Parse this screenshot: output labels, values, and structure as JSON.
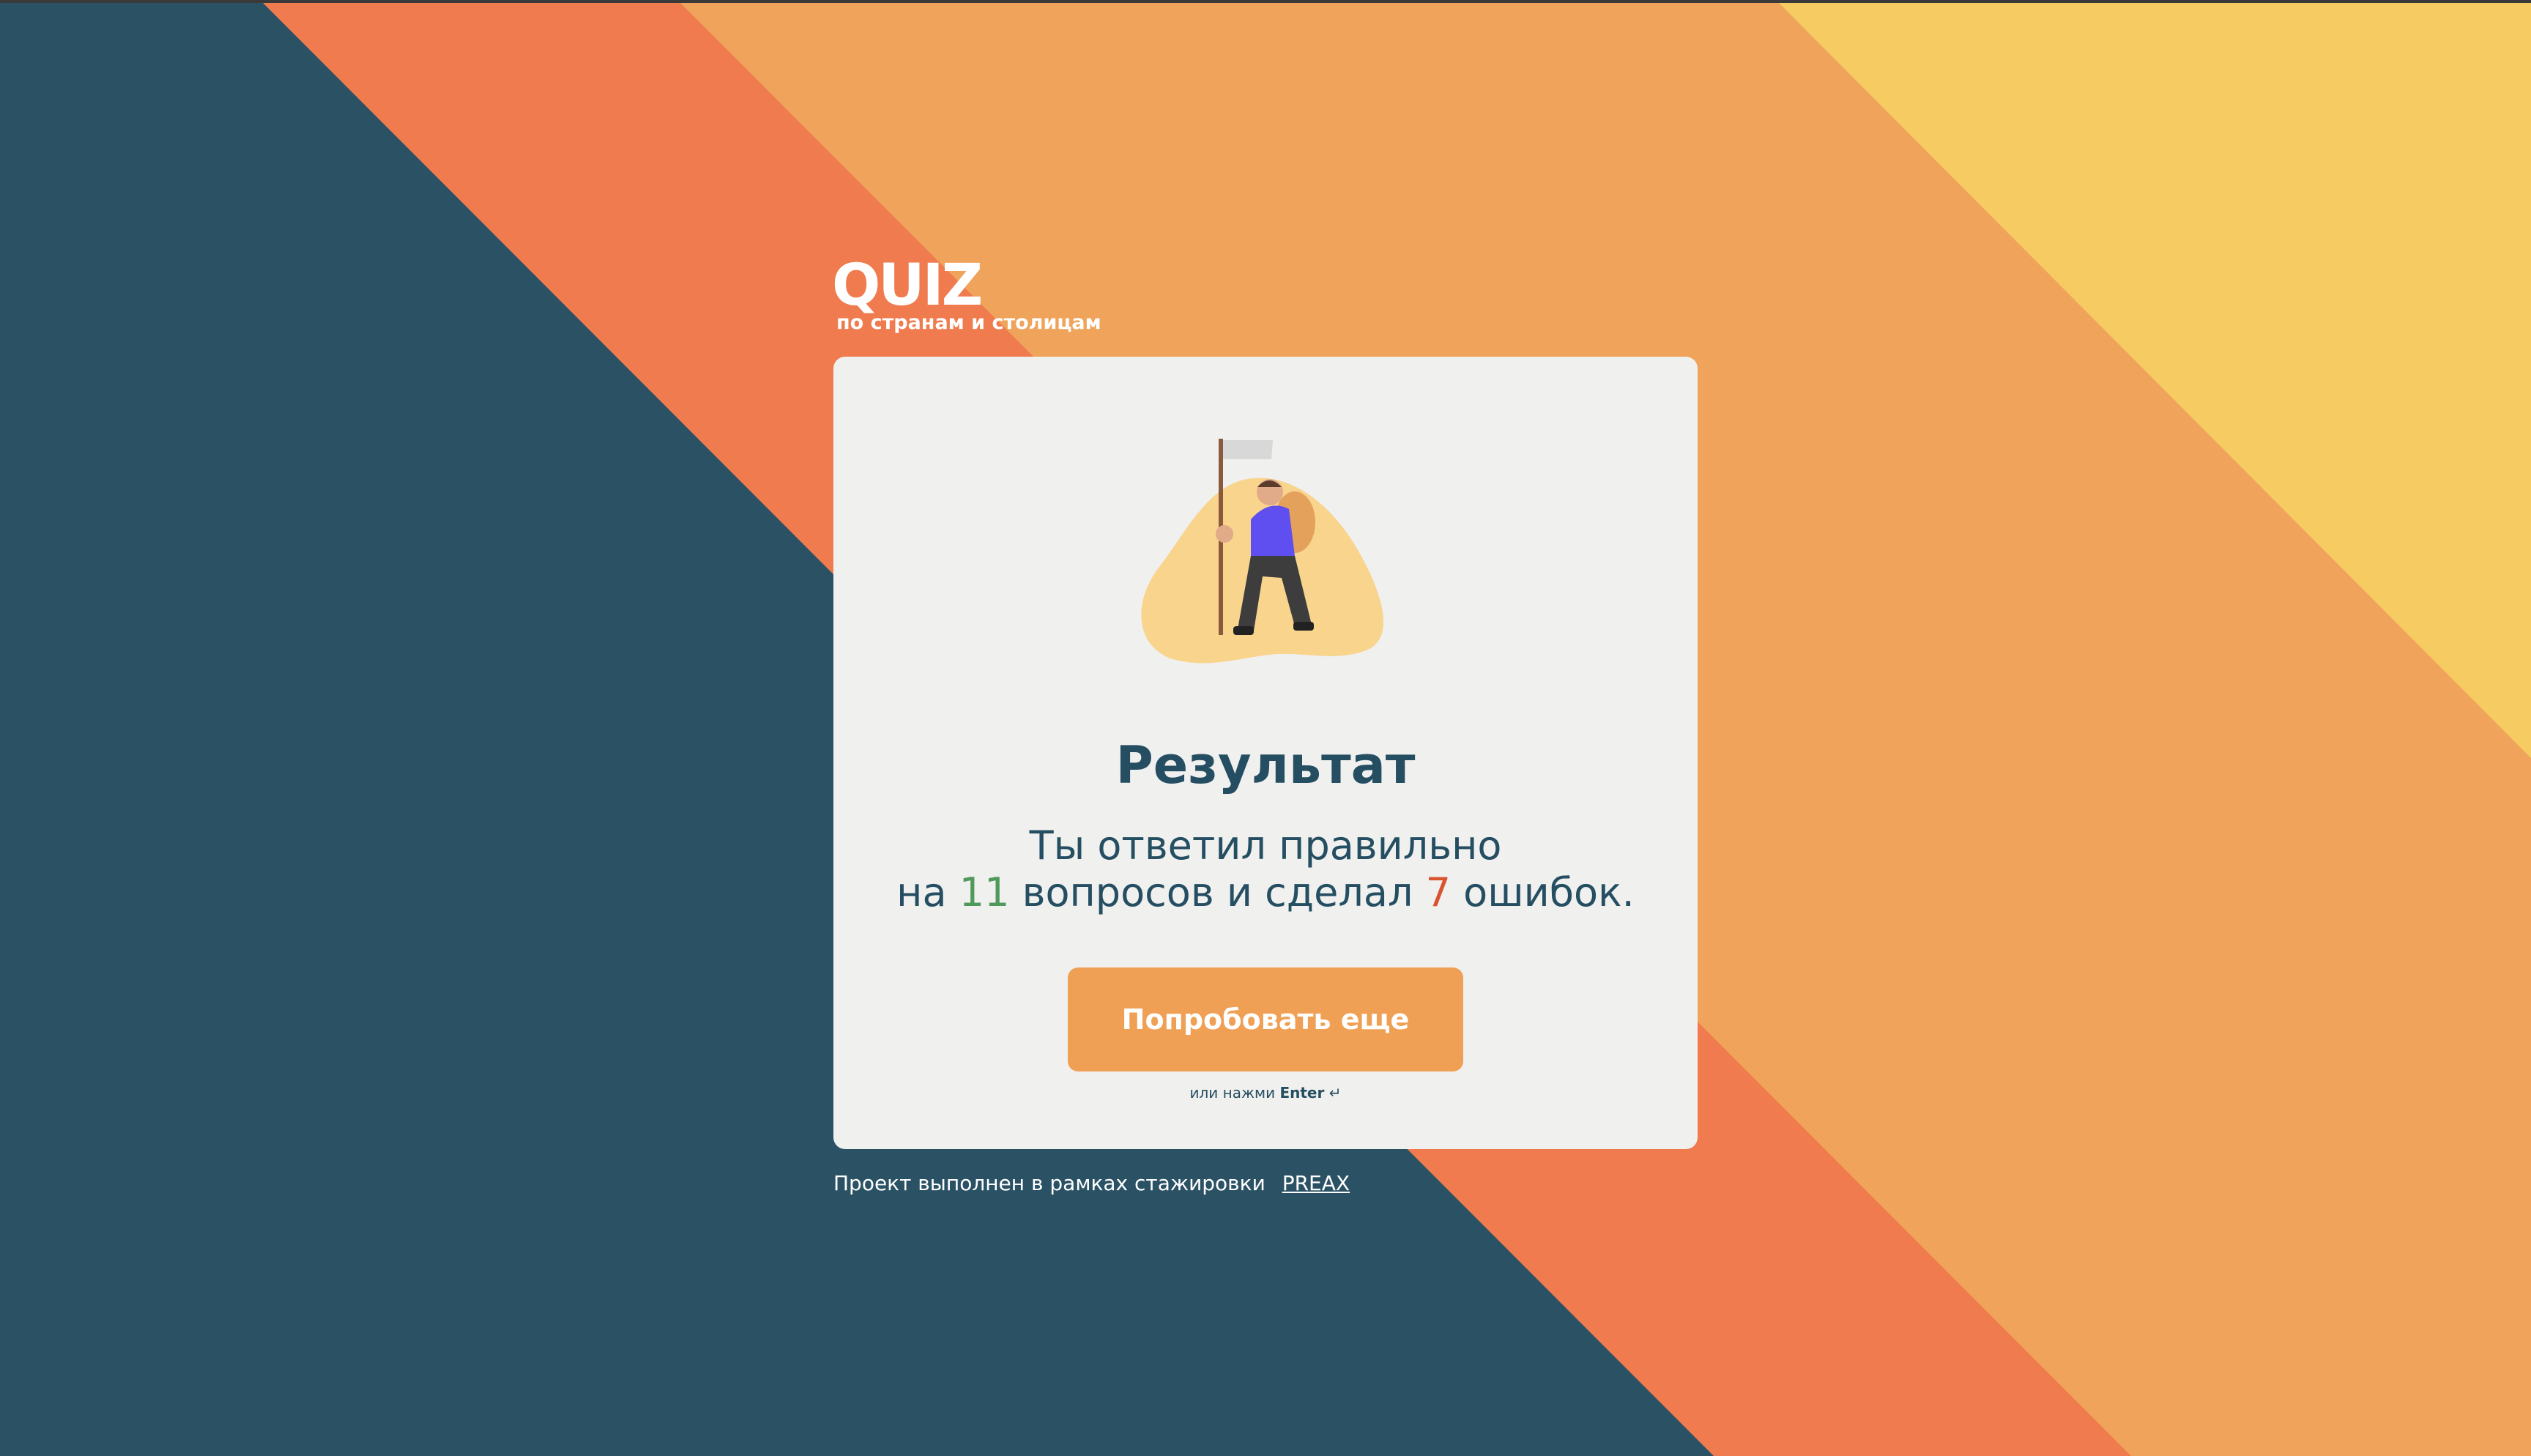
{
  "brand": {
    "title": "QUIZ",
    "subtitle": "по странам и столицам"
  },
  "result": {
    "heading": "Результат",
    "line1": "Ты ответил правильно",
    "line2_prefix": "на",
    "correct_count": "11",
    "line2_middle": "вопросов и сделал",
    "mistakes_count": "7",
    "line2_suffix": "ошибок."
  },
  "actions": {
    "retry_label": "Попробовать еще",
    "hint_prefix": "или нажми",
    "hint_key": "Enter",
    "hint_icon": "↵"
  },
  "footer": {
    "text": "Проект выполнен в рамках стажировки",
    "link_label": "PREAX"
  },
  "colors": {
    "dark_blue": "#2a5164",
    "orange_red": "#ef7b4f",
    "orange": "#f0a35a",
    "yellow": "#f6cb62",
    "card_bg": "#f0f0ef",
    "button": "#f0a055",
    "correct": "#4f9a5b",
    "mistakes": "#d8532f"
  },
  "icons": {
    "illustration": "hiker-with-flag-illustration",
    "enter": "enter-return-icon"
  }
}
